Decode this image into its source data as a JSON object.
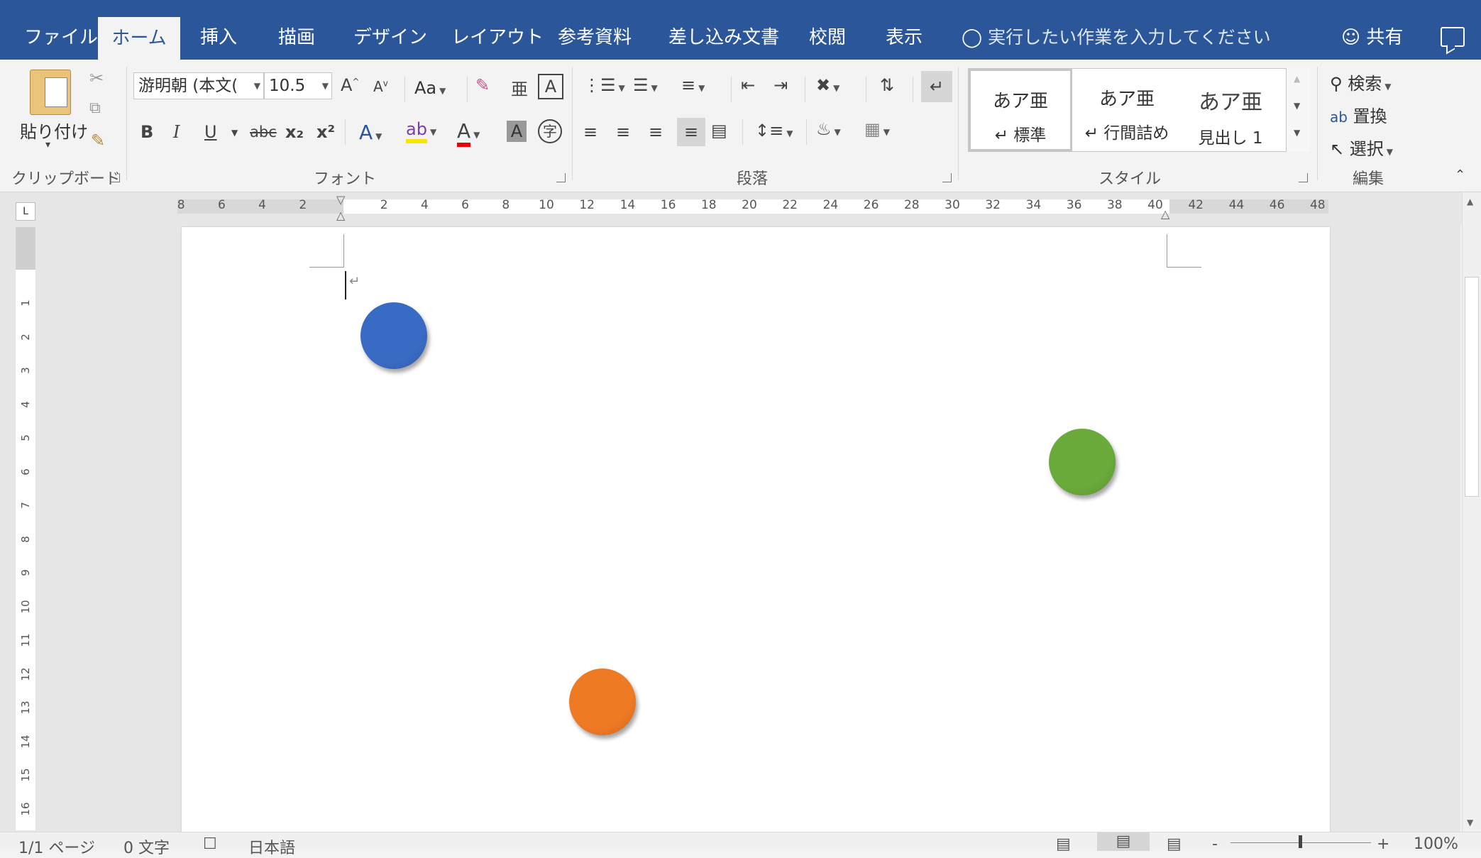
{
  "tabs": [
    "ファイル",
    "ホーム",
    "挿入",
    "描画",
    "デザイン",
    "レイアウト",
    "参考資料",
    "差し込み文書",
    "校閲",
    "表示"
  ],
  "tell_me": "実行したい作業を入力してください",
  "share": "共有",
  "clipboard": {
    "paste": "貼り付け",
    "label": "クリップボード"
  },
  "font": {
    "name": "游明朝 (本文(",
    "size": "10.5",
    "case": "Aa",
    "label": "フォント",
    "bold": "B",
    "italic": "I",
    "underline": "U",
    "strike": "abc",
    "sub": "x₂",
    "sup": "x²"
  },
  "paragraph": {
    "label": "段落"
  },
  "styles": {
    "label": "スタイル",
    "items": [
      {
        "preview": "あア亜",
        "name": "↵ 標準"
      },
      {
        "preview": "あア亜",
        "name": "↵ 行間詰め"
      },
      {
        "preview": "あア亜",
        "name": "見出し 1"
      }
    ]
  },
  "editing": {
    "label": "編集",
    "find": "検索",
    "replace": "置換",
    "select": "選択"
  },
  "ruler": {
    "left": [
      "8",
      "6",
      "4",
      "2"
    ],
    "right": [
      "2",
      "4",
      "6",
      "8",
      "10",
      "12",
      "14",
      "16",
      "18",
      "20",
      "22",
      "24",
      "26",
      "28",
      "30",
      "32",
      "34",
      "36",
      "38",
      "40",
      "42",
      "44",
      "46",
      "48"
    ]
  },
  "vruler": [
    "1",
    "2",
    "3",
    "4",
    "5",
    "6",
    "7",
    "8",
    "9",
    "10",
    "11",
    "12",
    "13",
    "14",
    "15",
    "16"
  ],
  "shapes": [
    {
      "name": "blue-circle",
      "color": "#3a6bc4"
    },
    {
      "name": "green-circle",
      "color": "#6aaa3a"
    },
    {
      "name": "orange-circle",
      "color": "#ef7a24"
    }
  ],
  "status": {
    "page": "1/1 ページ",
    "words": "0 文字",
    "lang": "日本語",
    "zoom": "100%"
  }
}
